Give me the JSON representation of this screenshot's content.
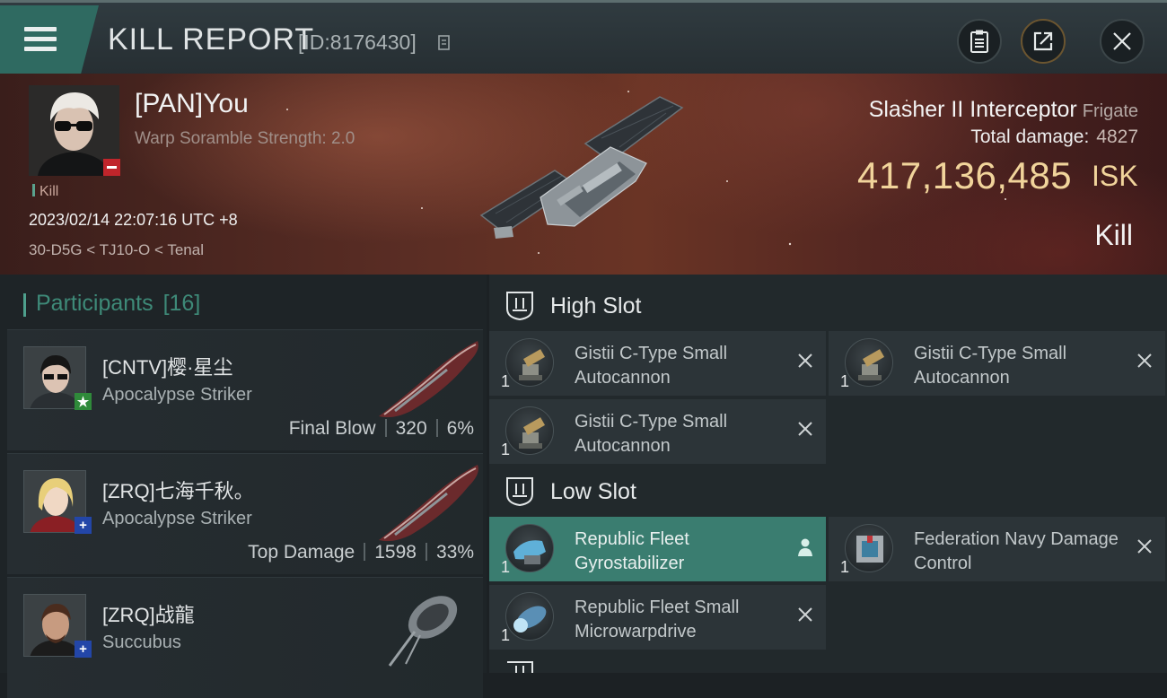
{
  "header": {
    "title": "KILL REPORT",
    "report_id": "[ID:8176430]",
    "icons": [
      "menu-icon",
      "copy-icon",
      "clipboard-icon",
      "share-icon",
      "close-icon"
    ]
  },
  "victim": {
    "name": "[PAN]You",
    "warp_scramble": "Warp Soramble Strength: 2.0",
    "result_tag": "Kill",
    "datetime": "2023/02/14 22:07:16 UTC +8",
    "location": "30-D5G < TJ10-O < Tenal",
    "ship_name": "Slasher II Interceptor",
    "ship_class": "Frigate",
    "total_damage_label": "Total damage:",
    "total_damage": "4827",
    "isk_value": "417,136,485",
    "isk_unit": "ISK",
    "result_big": "Kill"
  },
  "participants": {
    "label": "Participants",
    "count": "[16]",
    "items": [
      {
        "name": "[CNTV]樱·星尘",
        "ship": "Apocalypse Striker",
        "role": "Final Blow",
        "damage": "320",
        "percent": "6%",
        "badge": "star-icon",
        "badge_color": "#2f8a3a"
      },
      {
        "name": "[ZRQ]七海千秋。",
        "ship": "Apocalypse Striker",
        "role": "Top Damage",
        "damage": "1598",
        "percent": "33%",
        "badge": "plus-icon",
        "badge_color": "#2346a8"
      },
      {
        "name": "[ZRQ]战龍",
        "ship": "Succubus",
        "role": "",
        "damage": "",
        "percent": "",
        "badge": "plus-icon",
        "badge_color": "#2346a8"
      }
    ]
  },
  "slots": {
    "high": {
      "title": "High Slot",
      "modules": [
        {
          "name": "Gistii C-Type Small Autocannon",
          "qty": "1"
        },
        {
          "name": "Gistii C-Type Small Autocannon",
          "qty": "1"
        },
        {
          "name": "Gistii C-Type Small Autocannon",
          "qty": "1"
        }
      ]
    },
    "low": {
      "title": "Low Slot",
      "modules": [
        {
          "name": "Republic Fleet Gyrostabilizer",
          "qty": "1",
          "status": "dropped"
        },
        {
          "name": "Federation Navy Damage Control",
          "qty": "1",
          "status": "destroyed"
        },
        {
          "name": "Republic Fleet Small Microwarpdrive",
          "qty": "1",
          "status": "destroyed"
        }
      ]
    }
  },
  "colors": {
    "accent": "#3a7d70",
    "isk": "#f1d49b",
    "header_menu": "#2f6a61"
  }
}
